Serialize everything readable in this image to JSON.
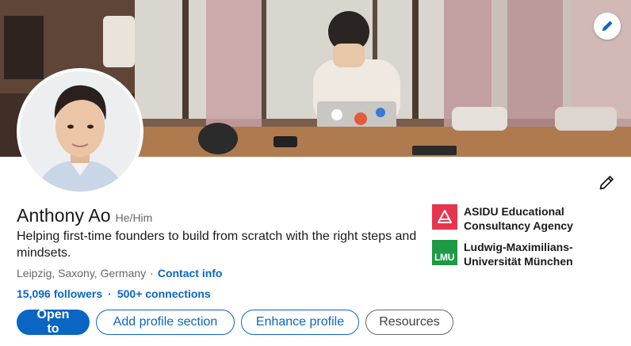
{
  "profile": {
    "name": "Anthony Ao",
    "pronouns": "He/Him",
    "headline": "Helping first-time founders to build from scratch with the right steps and mindsets.",
    "location": "Leipzig, Saxony, Germany",
    "location_separator": "·",
    "contact_info": "Contact info",
    "followers": "15,096 followers",
    "network_separator": "·",
    "connections": "500+ connections"
  },
  "actions": {
    "open_to": "Open to",
    "add_section": "Add profile section",
    "enhance": "Enhance profile",
    "resources": "Resources"
  },
  "organizations": [
    {
      "name": "ASIDU Educational Consultancy Agency",
      "icon": "asidu-logo",
      "color": "#e8344e"
    },
    {
      "name": "Ludwig-Maximilians-Universität München",
      "icon": "lmu-logo",
      "color": "#1c9a46",
      "logo_text": "LMU"
    }
  ],
  "colors": {
    "accent": "#0a66c2",
    "text": "#191919",
    "muted": "#666666"
  }
}
